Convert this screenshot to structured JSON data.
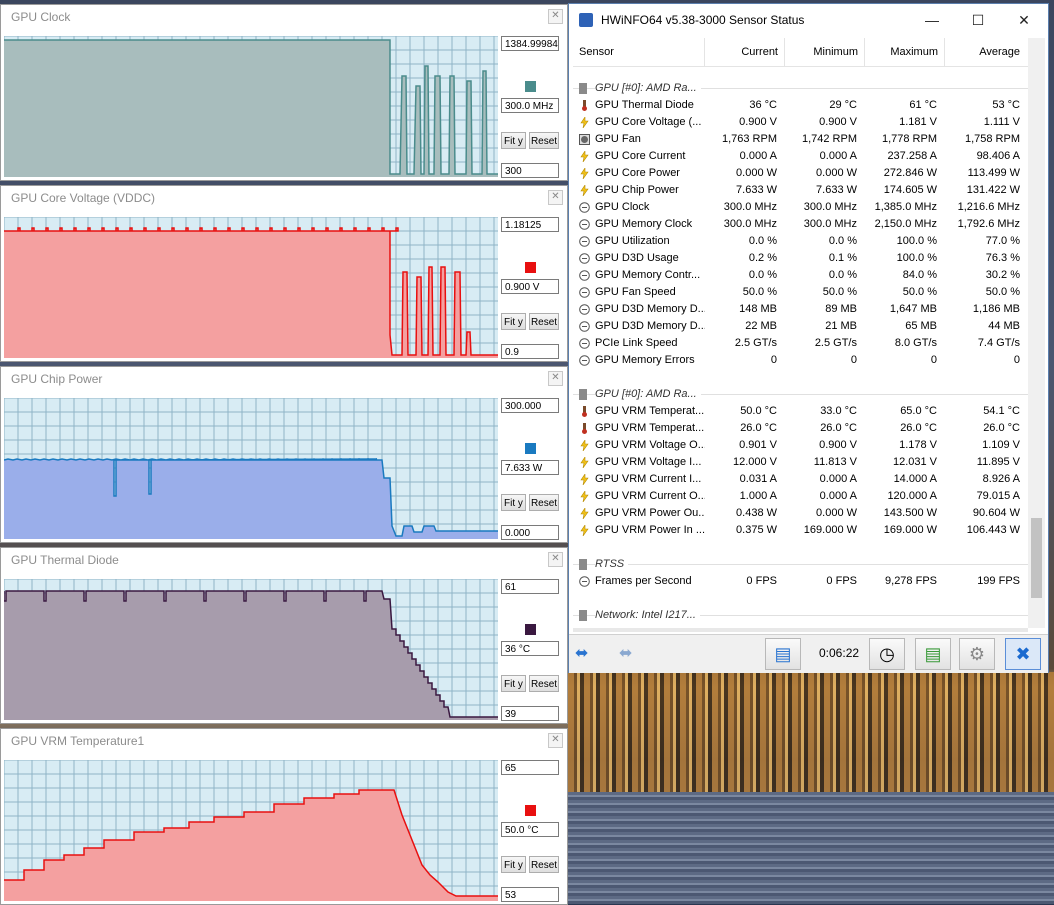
{
  "graphs": [
    {
      "title": "GPU Clock",
      "max": "1384.99984",
      "current": "300.0 MHz",
      "min": "300",
      "fit": "Fit y",
      "reset": "Reset",
      "color": "#4a8c8c",
      "fill": "#a8bdbd"
    },
    {
      "title": "GPU Core Voltage (VDDC)",
      "max": "1.18125",
      "current": "0.900 V",
      "min": "0.9",
      "fit": "Fit y",
      "reset": "Reset",
      "color": "#e81010",
      "fill": "#f4a0a0"
    },
    {
      "title": "GPU Chip Power",
      "max": "300.000",
      "current": "7.633 W",
      "min": "0.000",
      "fit": "Fit y",
      "reset": "Reset",
      "color": "#1a7ac0",
      "fill": "#9aaeea"
    },
    {
      "title": "GPU Thermal Diode",
      "max": "61",
      "current": "36 °C",
      "min": "39",
      "fit": "Fit y",
      "reset": "Reset",
      "color": "#3a1840",
      "fill": "#a79cac"
    },
    {
      "title": "GPU VRM Temperature1",
      "max": "65",
      "current": "50.0 °C",
      "min": "53",
      "fit": "Fit y",
      "reset": "Reset",
      "color": "#e81010",
      "fill": "#f4a0a0"
    }
  ],
  "hwinfo": {
    "title": "HWiNFO64 v5.38-3000 Sensor Status",
    "columns": [
      "Sensor",
      "Current",
      "Minimum",
      "Maximum",
      "Average"
    ],
    "rows": [
      {
        "type": "group",
        "name": "GPU [#0]: AMD Ra..."
      },
      {
        "icon": "thermometer",
        "name": "GPU Thermal Diode",
        "cur": "36 °C",
        "min": "29 °C",
        "max": "61 °C",
        "avg": "53 °C"
      },
      {
        "icon": "bolt",
        "name": "GPU Core Voltage (...",
        "cur": "0.900 V",
        "min": "0.900 V",
        "max": "1.181 V",
        "avg": "1.111 V"
      },
      {
        "icon": "fan",
        "name": "GPU Fan",
        "cur": "1,763 RPM",
        "min": "1,742 RPM",
        "max": "1,778 RPM",
        "avg": "1,758 RPM"
      },
      {
        "icon": "bolt",
        "name": "GPU Core Current",
        "cur": "0.000 A",
        "min": "0.000 A",
        "max": "237.258 A",
        "avg": "98.406 A"
      },
      {
        "icon": "bolt",
        "name": "GPU Core Power",
        "cur": "0.000 W",
        "min": "0.000 W",
        "max": "272.846 W",
        "avg": "113.499 W"
      },
      {
        "icon": "bolt",
        "name": "GPU Chip Power",
        "cur": "7.633 W",
        "min": "7.633 W",
        "max": "174.605 W",
        "avg": "131.422 W"
      },
      {
        "icon": "clock",
        "name": "GPU Clock",
        "cur": "300.0 MHz",
        "min": "300.0 MHz",
        "max": "1,385.0 MHz",
        "avg": "1,216.6 MHz"
      },
      {
        "icon": "clock",
        "name": "GPU Memory Clock",
        "cur": "300.0 MHz",
        "min": "300.0 MHz",
        "max": "2,150.0 MHz",
        "avg": "1,792.6 MHz"
      },
      {
        "icon": "clock",
        "name": "GPU Utilization",
        "cur": "0.0 %",
        "min": "0.0 %",
        "max": "100.0 %",
        "avg": "77.0 %"
      },
      {
        "icon": "clock",
        "name": "GPU D3D Usage",
        "cur": "0.2 %",
        "min": "0.1 %",
        "max": "100.0 %",
        "avg": "76.3 %"
      },
      {
        "icon": "clock",
        "name": "GPU Memory Contr...",
        "cur": "0.0 %",
        "min": "0.0 %",
        "max": "84.0 %",
        "avg": "30.2 %"
      },
      {
        "icon": "clock",
        "name": "GPU Fan Speed",
        "cur": "50.0 %",
        "min": "50.0 %",
        "max": "50.0 %",
        "avg": "50.0 %"
      },
      {
        "icon": "clock",
        "name": "GPU D3D Memory D...",
        "cur": "148 MB",
        "min": "89 MB",
        "max": "1,647 MB",
        "avg": "1,186 MB"
      },
      {
        "icon": "clock",
        "name": "GPU D3D Memory D...",
        "cur": "22 MB",
        "min": "21 MB",
        "max": "65 MB",
        "avg": "44 MB"
      },
      {
        "icon": "clock",
        "name": "PCIe Link Speed",
        "cur": "2.5 GT/s",
        "min": "2.5 GT/s",
        "max": "8.0 GT/s",
        "avg": "7.4 GT/s"
      },
      {
        "icon": "clock",
        "name": "GPU Memory Errors",
        "cur": "0",
        "min": "0",
        "max": "0",
        "avg": "0"
      },
      {
        "type": "blank"
      },
      {
        "type": "group",
        "name": "GPU [#0]: AMD Ra..."
      },
      {
        "icon": "thermometer",
        "name": "GPU VRM Temperat...",
        "cur": "50.0 °C",
        "min": "33.0 °C",
        "max": "65.0 °C",
        "avg": "54.1 °C"
      },
      {
        "icon": "thermometer",
        "name": "GPU VRM Temperat...",
        "cur": "26.0 °C",
        "min": "26.0 °C",
        "max": "26.0 °C",
        "avg": "26.0 °C"
      },
      {
        "icon": "bolt",
        "name": "GPU VRM Voltage O...",
        "cur": "0.901 V",
        "min": "0.900 V",
        "max": "1.178 V",
        "avg": "1.109 V"
      },
      {
        "icon": "bolt",
        "name": "GPU VRM Voltage I...",
        "cur": "12.000 V",
        "min": "11.813 V",
        "max": "12.031 V",
        "avg": "11.895 V"
      },
      {
        "icon": "bolt",
        "name": "GPU VRM Current I...",
        "cur": "0.031 A",
        "min": "0.000 A",
        "max": "14.000 A",
        "avg": "8.926 A"
      },
      {
        "icon": "bolt",
        "name": "GPU VRM Current O...",
        "cur": "1.000 A",
        "min": "0.000 A",
        "max": "120.000 A",
        "avg": "79.015 A"
      },
      {
        "icon": "bolt",
        "name": "GPU VRM Power Ou...",
        "cur": "0.438 W",
        "min": "0.000 W",
        "max": "143.500 W",
        "avg": "90.604 W"
      },
      {
        "icon": "bolt",
        "name": "GPU VRM Power In ...",
        "cur": "0.375 W",
        "min": "169.000 W",
        "max": "169.000 W",
        "avg": "106.443 W"
      },
      {
        "type": "blank"
      },
      {
        "type": "group",
        "name": "RTSS"
      },
      {
        "icon": "clock",
        "name": "Frames per Second",
        "cur": "0 FPS",
        "min": "0 FPS",
        "max": "9,278 FPS",
        "avg": "199 FPS"
      },
      {
        "type": "blank"
      },
      {
        "type": "group",
        "name": "Network: Intel I217..."
      }
    ],
    "timer": "0:06:22"
  }
}
